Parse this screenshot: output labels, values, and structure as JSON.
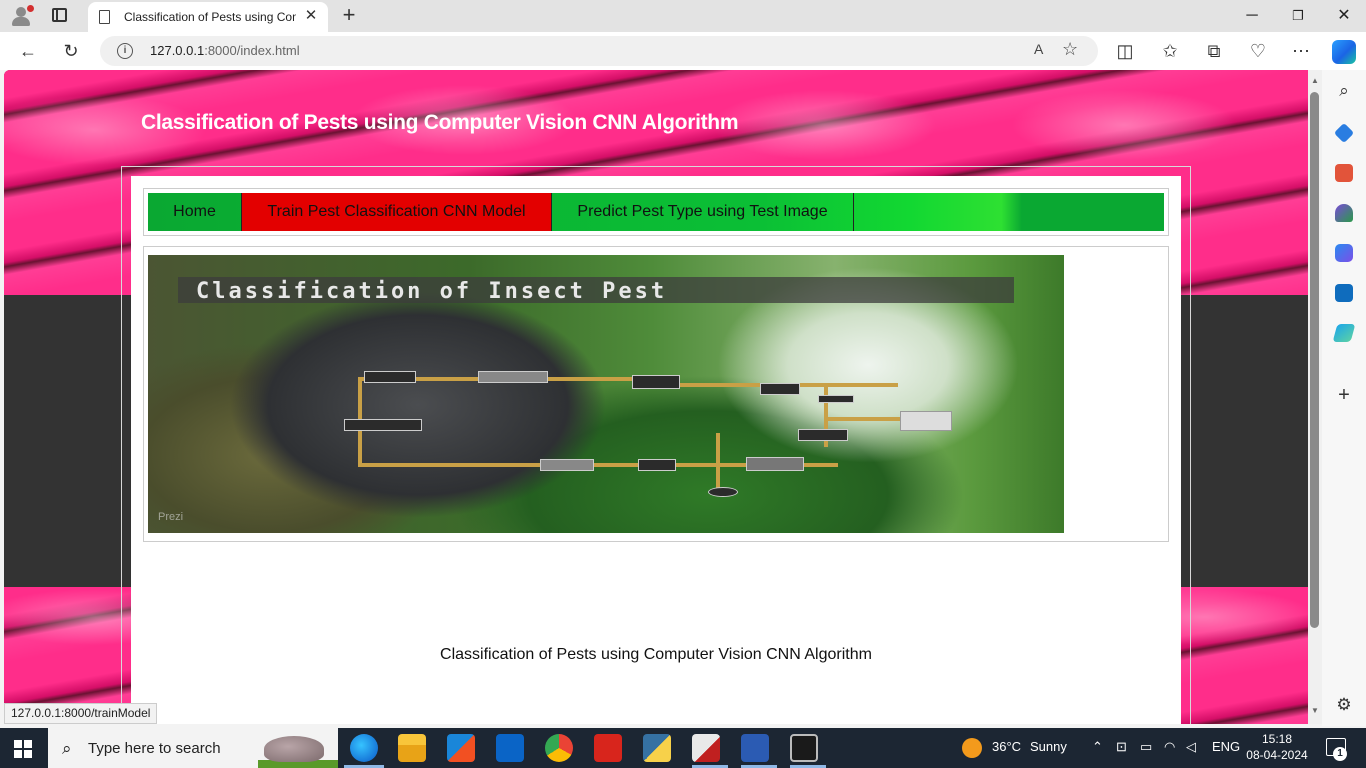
{
  "browser": {
    "tab_title": "Classification of Pests using Com",
    "tab_close": "✕",
    "new_tab": "+",
    "url_host": "127.0.0.1",
    "url_path": ":8000/index.html",
    "read_aloud": "A",
    "favorite": "☆",
    "back": "←",
    "refresh": "↻",
    "minimize": "─",
    "maximize": "❐",
    "close": "✕",
    "more": "⋯",
    "split": "◫",
    "favorites": "✩",
    "collections": "⧉",
    "performance": "♡",
    "status_url": "127.0.0.1:8000/trainModel"
  },
  "page": {
    "title": "Classification of Pests using Computer Vision CNN Algorithm",
    "nav": {
      "home": "Home",
      "train": "Train Pest Classification CNN Model",
      "predict": "Predict Pest Type using Test Image"
    },
    "banner_text": "Classification of Insect Pest",
    "banner_watermark": "Prezi",
    "subtitle": "Classification of Pests using Computer Vision CNN Algorithm"
  },
  "sidebar": {
    "icons": [
      "search-icon",
      "shopping-tag-icon",
      "toolbox-icon",
      "games-icon",
      "copilot-icon",
      "outlook-icon",
      "send-icon",
      "add-icon",
      "settings-icon"
    ],
    "add": "+",
    "settings": "⚙"
  },
  "taskbar": {
    "search_placeholder": "Type here to search",
    "weather_temp": "36°C",
    "weather_text": "Sunny",
    "language": "ENG",
    "time": "15:18",
    "date": "08-04-2024",
    "notification_count": "1",
    "apps": [
      "task-view-icon",
      "edge-icon",
      "file-explorer-icon",
      "store-icon",
      "mail-icon",
      "chrome-icon",
      "acrobat-icon",
      "python-icon",
      "paint-icon",
      "word-icon",
      "terminal-icon"
    ]
  },
  "colors": {
    "nav_green": "#0aa832",
    "nav_red": "#e30000",
    "header_pink": "#ff2d8a",
    "content_dark": "#333333",
    "taskbar": "#1c2633"
  }
}
